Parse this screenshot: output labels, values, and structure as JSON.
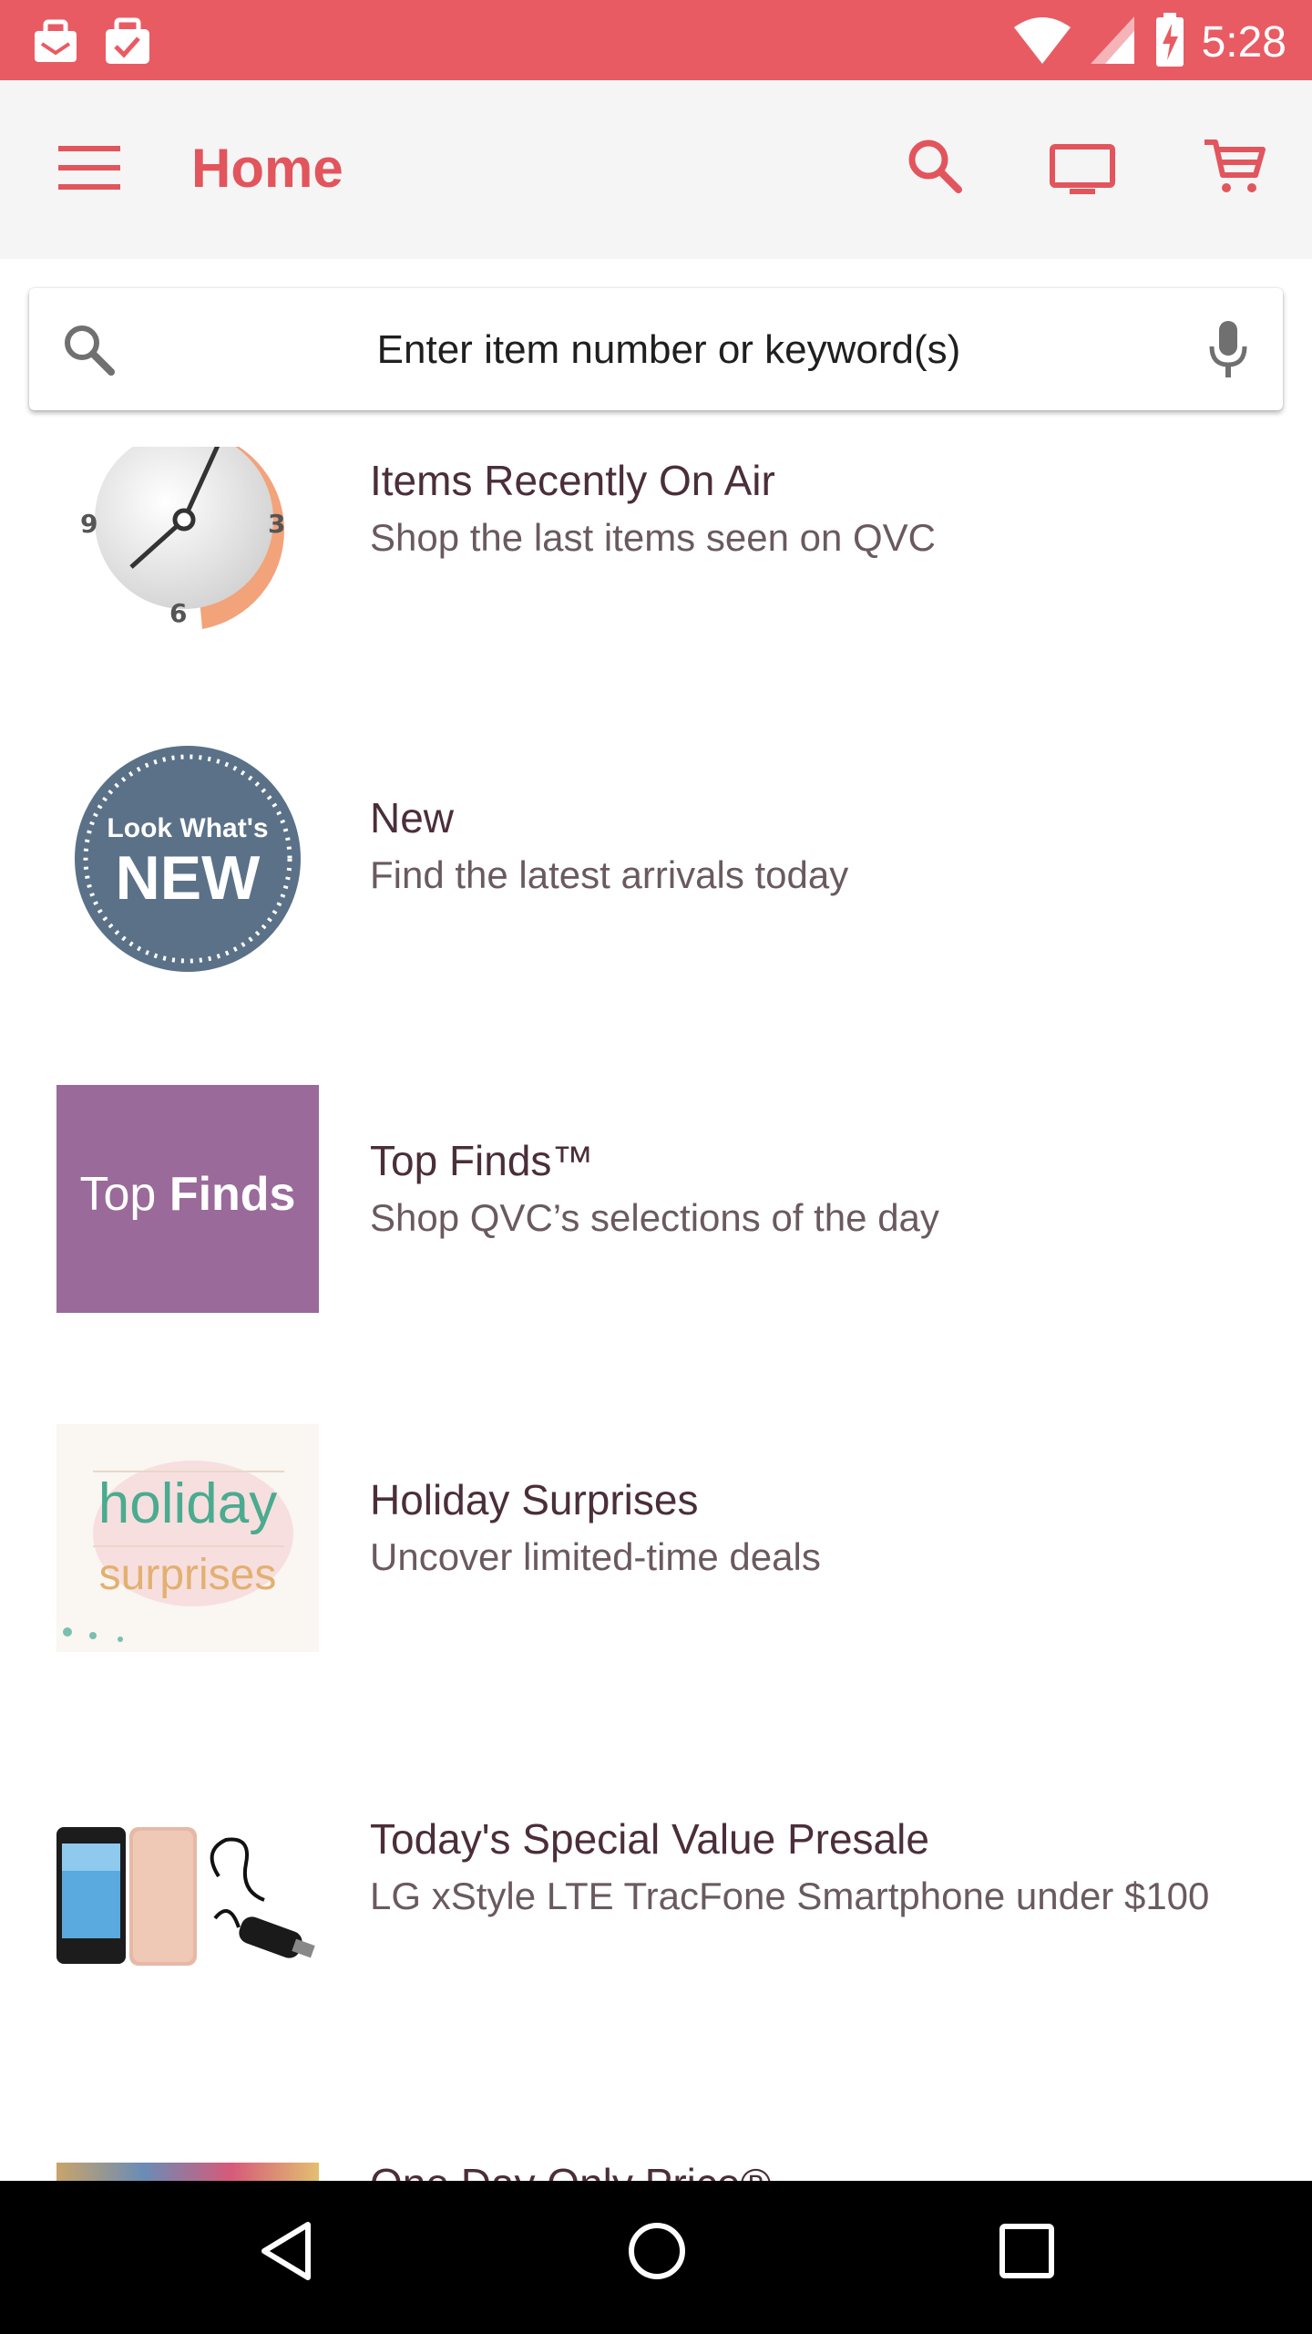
{
  "status_bar": {
    "time": "5:28",
    "left_icons": [
      "mail-bag-icon",
      "clipboard-check-icon"
    ],
    "right_icons": [
      "wifi-icon",
      "signal-icon",
      "battery-charging-icon"
    ]
  },
  "app_bar": {
    "title": "Home",
    "actions": [
      "search-icon",
      "tv-icon",
      "cart-icon"
    ]
  },
  "search": {
    "placeholder": "Enter item number or keyword(s)"
  },
  "items": [
    {
      "title": "Items Recently On Air",
      "subtitle": "Shop the last items seen on QVC",
      "thumb": "clock-icon"
    },
    {
      "title": "New",
      "subtitle": "Find the latest arrivals today",
      "thumb": "new-badge",
      "badge_line1": "Look What's",
      "badge_line2": "NEW"
    },
    {
      "title": "Top Finds™",
      "subtitle": "Shop QVC’s selections of the day",
      "thumb": "top-finds-tile",
      "tile_light": "Top ",
      "tile_bold": "Finds"
    },
    {
      "title": "Holiday Surprises",
      "subtitle": "Uncover limited-time deals",
      "thumb": "holiday-tile",
      "tile_line1": "holiday",
      "tile_line2": "surprises"
    },
    {
      "title": "Today's Special Value Presale",
      "subtitle": "LG xStyle LTE TracFone Smartphone under $100",
      "thumb": "phone-bundle-image"
    },
    {
      "title": "One Day Only Price®",
      "subtitle": "",
      "thumb": "product-image"
    }
  ],
  "nav_bar": [
    "back-icon",
    "home-icon",
    "recents-icon"
  ],
  "colors": {
    "brand": "#e95b63",
    "accent": "#e2555d",
    "purple_tile": "#9a6a9a",
    "badge_blue": "#5a7188"
  }
}
